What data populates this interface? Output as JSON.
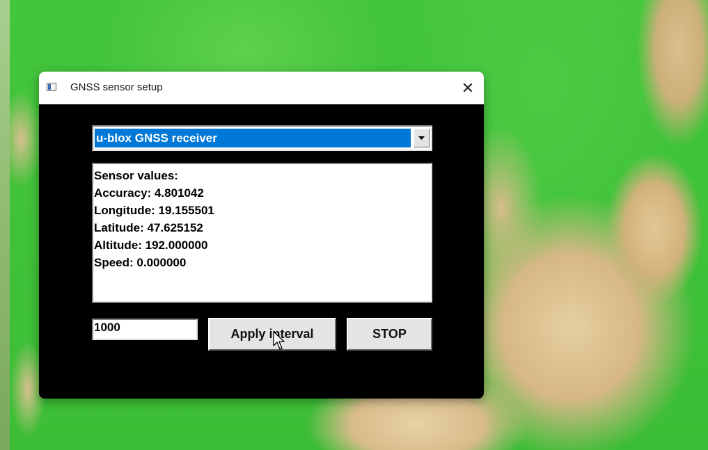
{
  "window": {
    "title": "GNSS sensor setup",
    "close_glyph": "✕"
  },
  "sensor_select": {
    "selected": "u-blox GNSS receiver"
  },
  "sensor_values": {
    "lines": [
      "Sensor values:",
      "Accuracy: 4.801042",
      "Longitude: 19.155501",
      "Latitude: 47.625152",
      "Altitude: 192.000000",
      "Speed: 0.000000"
    ]
  },
  "interval": {
    "value": "1000"
  },
  "buttons": {
    "apply_label": "Apply interval",
    "stop_label": "STOP"
  },
  "colors": {
    "selection": "#0078d7",
    "window_bg": "#000000",
    "button_face": "#e4e4e4"
  },
  "icons": {
    "window_icon": "app-window-icon",
    "close": "close-icon",
    "dropdown": "chevron-down-icon",
    "pointer": "mouse-cursor-icon"
  }
}
